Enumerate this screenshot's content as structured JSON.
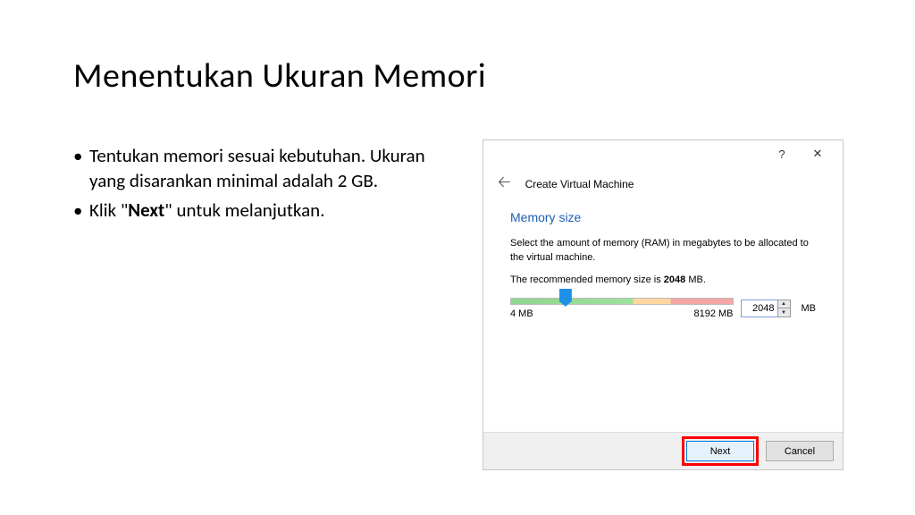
{
  "slide": {
    "title": "Menentukan Ukuran Memori",
    "bullet1": "Tentukan memori sesuai kebutuhan. Ukuran yang disarankan minimal adalah 2 GB.",
    "bullet2_prefix": "Klik \"",
    "bullet2_bold": "Next",
    "bullet2_suffix": "\" untuk melanjutkan."
  },
  "dialog": {
    "wizard_title": "Create Virtual Machine",
    "section_heading": "Memory size",
    "description": "Select the amount of memory (RAM) in megabytes to be allocated to the virtual machine.",
    "recommend_prefix": "The recommended memory size is ",
    "recommend_value": "2048",
    "recommend_suffix": " MB.",
    "slider": {
      "min_label": "4 MB",
      "max_label": "8192 MB",
      "value": "2048"
    },
    "unit": "MB",
    "buttons": {
      "next": "Next",
      "cancel": "Cancel"
    }
  }
}
